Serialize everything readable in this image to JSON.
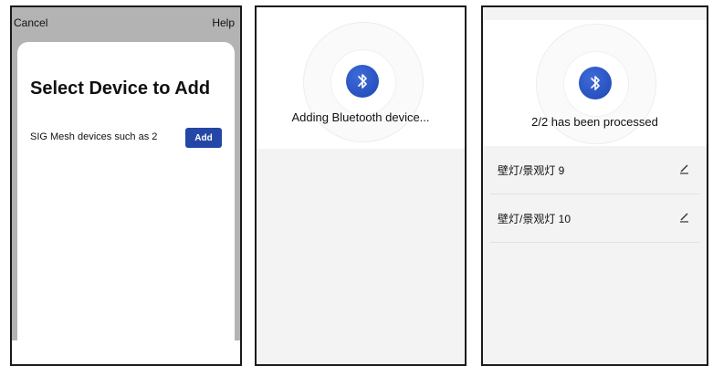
{
  "screen1": {
    "cancel_label": "Cancel",
    "help_label": "Help",
    "title": "Select Device to Add",
    "device_label": "SIG Mesh devices such as 2",
    "add_label": "Add"
  },
  "screen2": {
    "icon": "bluetooth-icon",
    "status": "Adding Bluetooth device..."
  },
  "screen3": {
    "icon": "bluetooth-icon",
    "status": "2/2 has been processed",
    "items": [
      {
        "name": "壁灯/景观灯 9",
        "icon": "edit-icon"
      },
      {
        "name": "壁灯/景观灯 10",
        "icon": "edit-icon"
      }
    ]
  },
  "colors": {
    "accent": "#2446a6",
    "bluetooth": "#1c46b3",
    "overlay": "#b3b3b3",
    "background": "#f3f3f3"
  }
}
